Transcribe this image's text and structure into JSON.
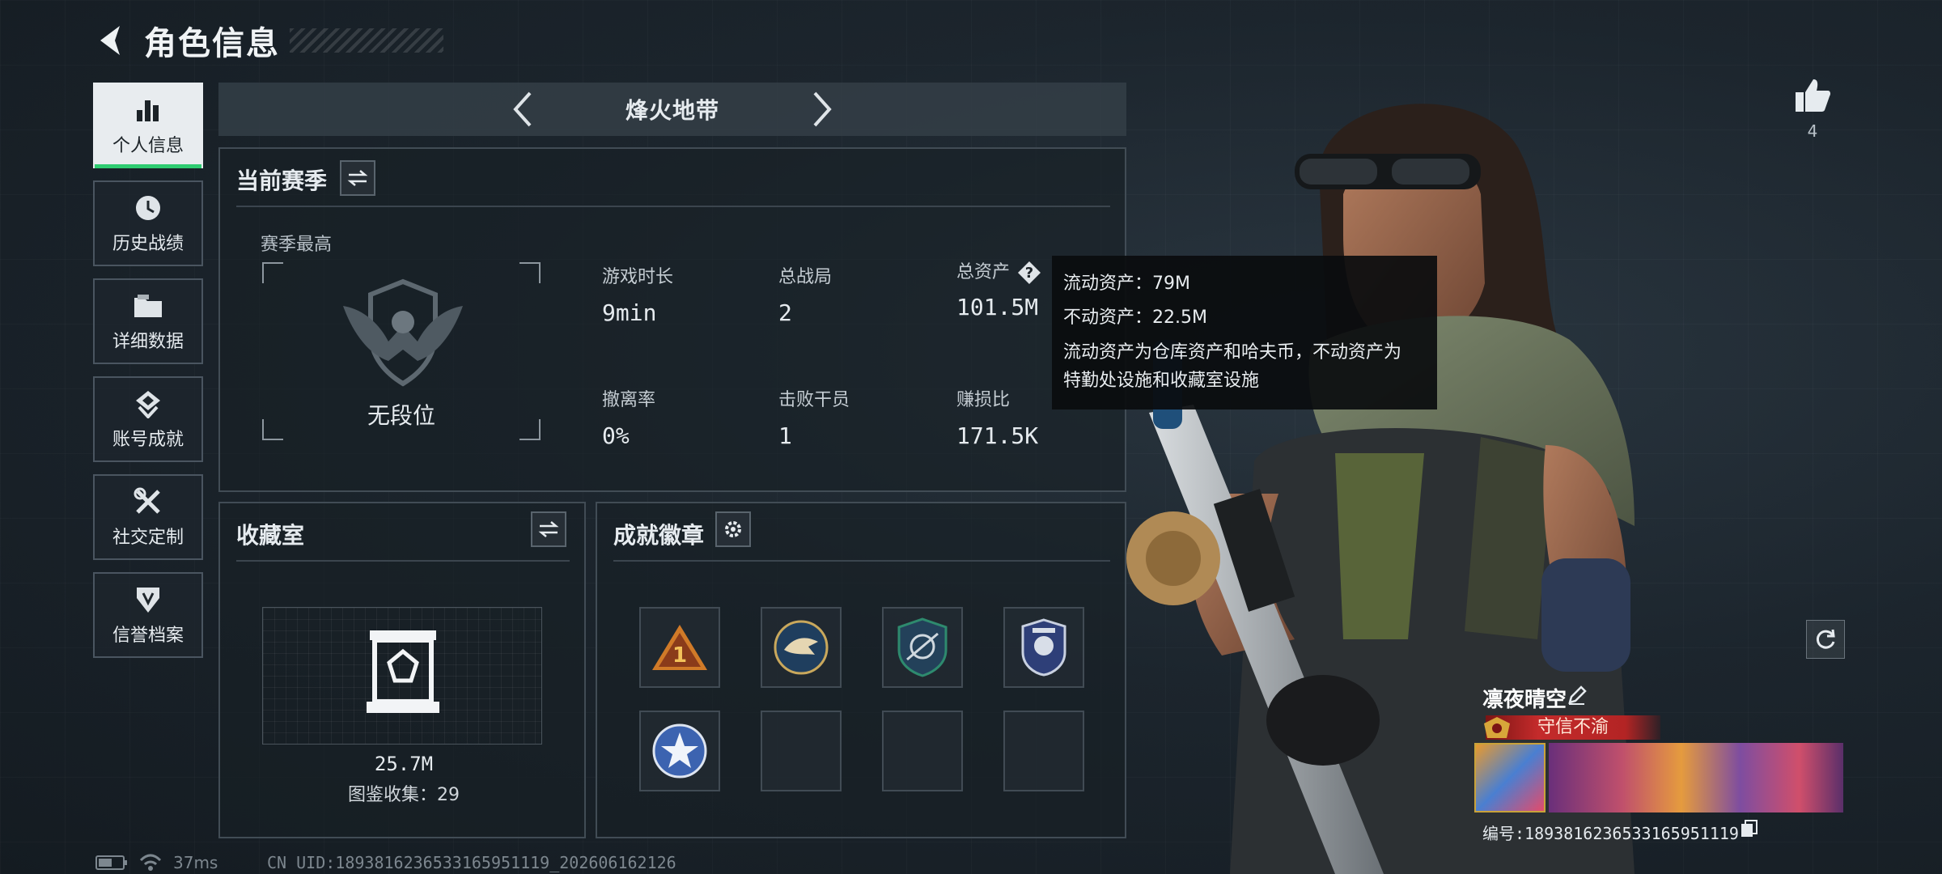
{
  "header": {
    "title": "角色信息"
  },
  "sidebar": {
    "items": [
      {
        "label": "个人信息",
        "icon": "bar-chart-icon"
      },
      {
        "label": "历史战绩",
        "icon": "clock-icon"
      },
      {
        "label": "详细数据",
        "icon": "folder-icon"
      },
      {
        "label": "账号成就",
        "icon": "achievement-icon"
      },
      {
        "label": "社交定制",
        "icon": "wrench-screwdriver-icon"
      },
      {
        "label": "信誉档案",
        "icon": "shield-badge-icon"
      }
    ]
  },
  "mode": {
    "name": "烽火地带"
  },
  "season": {
    "title": "当前赛季",
    "highest_label": "赛季最高",
    "rank_name": "无段位",
    "stats": {
      "play_time": {
        "label": "游戏时长",
        "value": "9min"
      },
      "total_matches": {
        "label": "总战局",
        "value": "2"
      },
      "total_assets": {
        "label": "总资产",
        "value": "101.5M"
      },
      "extract_rate": {
        "label": "撤离率",
        "value": "0%"
      },
      "kills": {
        "label": "击败干员",
        "value": "1"
      },
      "profit_ratio": {
        "label": "赚损比",
        "value": "171.5K"
      }
    }
  },
  "tooltip": {
    "liquid": "流动资产：79M",
    "fixed": "不动资产：22.5M",
    "desc_line1": "流动资产为仓库资产和哈夫币，不动资产为",
    "desc_line2": "特勤处设施和收藏室设施"
  },
  "collection": {
    "title": "收藏室",
    "value": "25.7M",
    "count_text": "图鉴收集：29"
  },
  "badges": {
    "title": "成就徽章",
    "items": [
      {
        "icon": "triangle-rank-1-badge-icon"
      },
      {
        "icon": "eagle-badge-icon"
      },
      {
        "icon": "shield-arrows-badge-icon"
      },
      {
        "icon": "crest-badge-icon"
      },
      {
        "icon": "star-badge-icon"
      },
      {
        "icon": ""
      },
      {
        "icon": ""
      },
      {
        "icon": ""
      }
    ]
  },
  "status": {
    "ping": "37ms",
    "uid": "CN UID:1893816236533165951119_202606162126"
  },
  "like": {
    "count": "4"
  },
  "player": {
    "name": "凛夜晴空",
    "title": "守信不渝",
    "id_text": "编号:1893816236533165951119"
  },
  "colors": {
    "active_tab_accent": "#2ecc71",
    "title_badge": "#c42b2b"
  }
}
